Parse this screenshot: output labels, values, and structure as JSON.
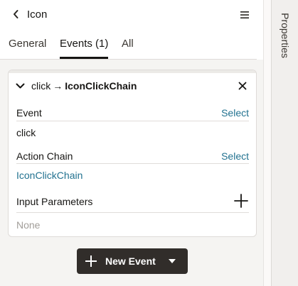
{
  "header": {
    "title": "Icon",
    "back_icon": "chevron-left-icon",
    "menu_icon": "hamburger-icon"
  },
  "tabs": [
    {
      "label": "General",
      "active": false
    },
    {
      "label": "Events (1)",
      "active": true
    },
    {
      "label": "All",
      "active": false
    }
  ],
  "side_panel": {
    "label": "Properties"
  },
  "event_card": {
    "event_name": "click",
    "arrow": "→",
    "chain_name": "IconClickChain",
    "fields": {
      "event": {
        "label": "Event",
        "action": "Select",
        "value": "click"
      },
      "action_chain": {
        "label": "Action Chain",
        "action": "Select",
        "value": "IconClickChain"
      },
      "input_parameters": {
        "label": "Input Parameters",
        "value": "None"
      }
    }
  },
  "new_event_button": {
    "label": "New Event"
  },
  "colors": {
    "link": "#227290",
    "button_bg": "#312d2a",
    "panel_bg": "#f5f4f2",
    "side_tab_bg": "#f1efed"
  }
}
